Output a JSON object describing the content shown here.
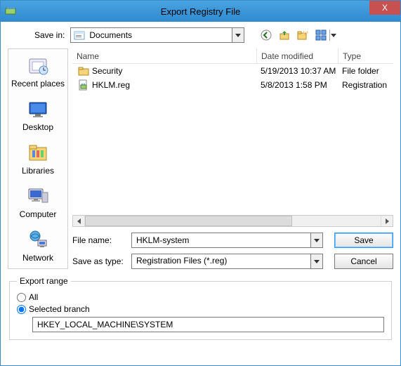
{
  "window": {
    "title": "Export Registry File"
  },
  "close_x": "X",
  "savein": {
    "label": "Save in:",
    "value": "Documents"
  },
  "columns": {
    "name": "Name",
    "date": "Date modified",
    "type": "Type"
  },
  "files": [
    {
      "icon": "folder",
      "name": "Security",
      "date": "5/19/2013 10:37 AM",
      "type": "File folder"
    },
    {
      "icon": "regfile",
      "name": "HKLM.reg",
      "date": "5/8/2013 1:58 PM",
      "type": "Registration"
    }
  ],
  "places": [
    {
      "key": "recent",
      "label": "Recent places"
    },
    {
      "key": "desktop",
      "label": "Desktop"
    },
    {
      "key": "libraries",
      "label": "Libraries"
    },
    {
      "key": "computer",
      "label": "Computer"
    },
    {
      "key": "network",
      "label": "Network"
    }
  ],
  "filename": {
    "label": "File name:",
    "value": "HKLM-system"
  },
  "savetype": {
    "label": "Save as type:",
    "value": "Registration Files (*.reg)"
  },
  "buttons": {
    "save": "Save",
    "cancel": "Cancel"
  },
  "export": {
    "legend": "Export range",
    "all": "All",
    "selected": "Selected branch",
    "branch": "HKEY_LOCAL_MACHINE\\SYSTEM",
    "choice": "selected"
  }
}
